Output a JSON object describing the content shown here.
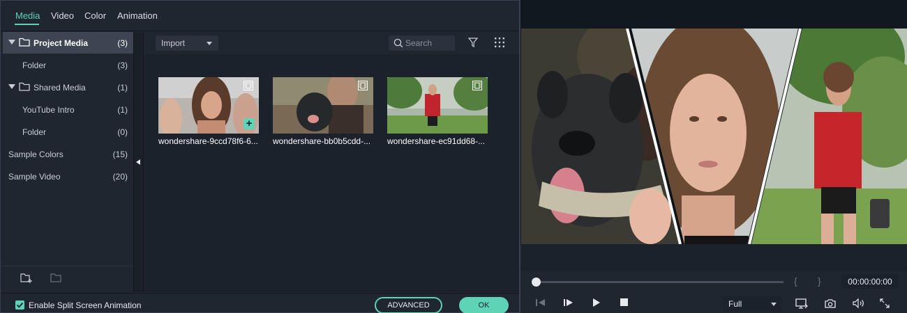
{
  "tabs": [
    {
      "label": "Media"
    },
    {
      "label": "Video"
    },
    {
      "label": "Color"
    },
    {
      "label": "Animation"
    }
  ],
  "sidebar": {
    "items": [
      {
        "label": "Project Media",
        "count": "(3)"
      },
      {
        "label": "Folder",
        "count": "(3)"
      },
      {
        "label": "Shared Media",
        "count": "(1)"
      },
      {
        "label": "YouTube Intro",
        "count": "(1)"
      },
      {
        "label": "Folder",
        "count": "(0)"
      },
      {
        "label": "Sample Colors",
        "count": "(15)"
      },
      {
        "label": "Sample Video",
        "count": "(20)"
      }
    ]
  },
  "toolbar": {
    "import_label": "Import",
    "search_placeholder": "Search"
  },
  "media": {
    "items": [
      {
        "name": "wondershare-9ccd78f6-6..."
      },
      {
        "name": "wondershare-bb0b5cdd-..."
      },
      {
        "name": "wondershare-ec91dd68-..."
      }
    ]
  },
  "bottom": {
    "split_label": "Enable Split Screen Animation",
    "advanced_label": "ADVANCED",
    "ok_label": "OK"
  },
  "player": {
    "timecode": "00:00:00:00",
    "zoom": "Full",
    "progress": 0,
    "mark_in": "{",
    "mark_out": "}"
  },
  "colors": {
    "accent": "#5fd3b6",
    "panel": "#1f262f",
    "background": "#121820"
  }
}
